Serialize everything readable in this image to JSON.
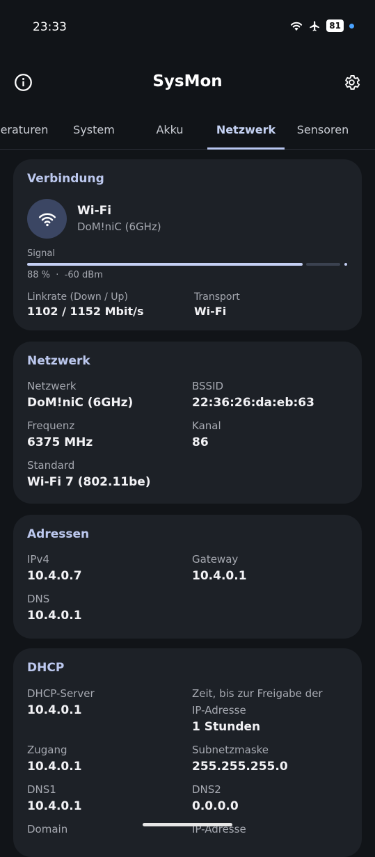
{
  "status_bar": {
    "time": "23:33",
    "battery": "81"
  },
  "app": {
    "title": "SysMon"
  },
  "tabs": [
    "eraturen",
    "System",
    "Akku",
    "Netzwerk",
    "Sensoren"
  ],
  "active_tab": "Netzwerk",
  "connection": {
    "title": "Verbindung",
    "type": "Wi-Fi",
    "ssid": "DoM!niC (6GHz)",
    "signal_label": "Signal",
    "signal_percent": 88,
    "signal_text": "88 %  ·  -60 dBm",
    "linkrate_label": "Linkrate (Down / Up)",
    "linkrate_value": "1102 / 1152 Mbit/s",
    "transport_label": "Transport",
    "transport_value": "Wi-Fi"
  },
  "network": {
    "title": "Netzwerk",
    "network_label": "Netzwerk",
    "network_value": "DoM!niC (6GHz)",
    "bssid_label": "BSSID",
    "bssid_value": "22:36:26:da:eb:63",
    "frequency_label": "Frequenz",
    "frequency_value": "6375 MHz",
    "channel_label": "Kanal",
    "channel_value": "86",
    "standard_label": "Standard",
    "standard_value": "Wi-Fi 7 (802.11be)"
  },
  "addresses": {
    "title": "Adressen",
    "ipv4_label": "IPv4",
    "ipv4_value": "10.4.0.7",
    "gateway_label": "Gateway",
    "gateway_value": "10.4.0.1",
    "dns_label": "DNS",
    "dns_value": "10.4.0.1"
  },
  "dhcp": {
    "title": "DHCP",
    "server_label": "DHCP-Server",
    "server_value": "10.4.0.1",
    "lease_label_1": "Zeit, bis zur Freigabe der",
    "lease_label_2": "IP-Adresse",
    "lease_value": "1 Stunden",
    "access_label": "Zugang",
    "access_value": "10.4.0.1",
    "subnet_label": "Subnetzmaske",
    "subnet_value": "255.255.255.0",
    "dns1_label": "DNS1",
    "dns1_value": "10.4.0.1",
    "dns2_label": "DNS2",
    "dns2_value": "0.0.0.0",
    "domain_label": "Domain",
    "ip_label": "IP-Adresse"
  }
}
